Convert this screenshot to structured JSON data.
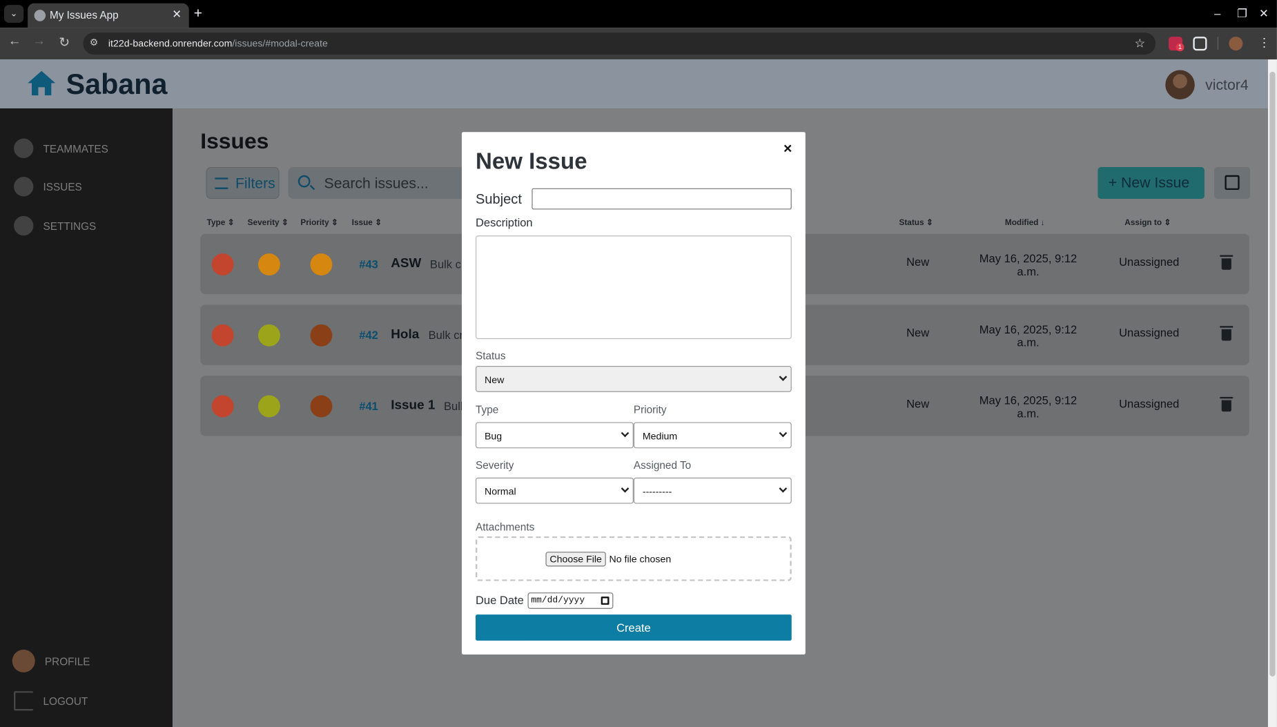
{
  "browser": {
    "tab_title": "My Issues App",
    "url_host": "it22d-backend.onrender.com",
    "url_path": "/issues/#modal-create",
    "ext_badge": "1"
  },
  "header": {
    "brand": "Sabana",
    "username": "victor4"
  },
  "sidebar": {
    "items": [
      {
        "label": "TEAMMATES",
        "icon": "teammates-icon"
      },
      {
        "label": "ISSUES",
        "icon": "bug-icon"
      },
      {
        "label": "SETTINGS",
        "icon": "gear-icon"
      }
    ],
    "profile": "PROFILE",
    "logout": "LOGOUT"
  },
  "main": {
    "title": "Issues",
    "filters_label": "Filters",
    "search_placeholder": "Search issues...",
    "new_issue_label": "New Issue",
    "columns": [
      "Type",
      "Severity",
      "Priority",
      "Issue",
      "Status",
      "Modified",
      "Assign to"
    ],
    "rows": [
      {
        "type_color": "#c4452d",
        "severity_color": "#d6870f",
        "priority_color": "#d6870f",
        "number": "#43",
        "subject": "ASW",
        "desc": "Bulk c",
        "status": "New",
        "modified_1": "May 16, 2025, 9:12",
        "modified_2": "a.m.",
        "assigned": "Unassigned"
      },
      {
        "type_color": "#c4452d",
        "severity_color": "#9ca41a",
        "priority_color": "#8a3f17",
        "number": "#42",
        "subject": "Hola",
        "desc": "Bulk cr",
        "status": "New",
        "modified_1": "May 16, 2025, 9:12",
        "modified_2": "a.m.",
        "assigned": "Unassigned"
      },
      {
        "type_color": "#c4452d",
        "severity_color": "#9ca41a",
        "priority_color": "#8a3f17",
        "number": "#41",
        "subject": "Issue 1",
        "desc": "Bull",
        "status": "New",
        "modified_1": "May 16, 2025, 9:12",
        "modified_2": "a.m.",
        "assigned": "Unassigned"
      }
    ]
  },
  "modal": {
    "close": "×",
    "title": "New Issue",
    "subject_label": "Subject",
    "subject_value": "",
    "description_label": "Description",
    "description_value": "",
    "status_label": "Status",
    "status_value": "New",
    "type_label": "Type",
    "type_value": "Bug",
    "priority_label": "Priority",
    "priority_value": "Medium",
    "severity_label": "Severity",
    "severity_value": "Normal",
    "assigned_label": "Assigned To",
    "assigned_value": "---------",
    "attachments_label": "Attachments",
    "choose_file": "Choose File",
    "no_file": "No file chosen",
    "due_label": "Due Date",
    "due_value": "mm/dd/yyyy",
    "create_label": "Create"
  }
}
